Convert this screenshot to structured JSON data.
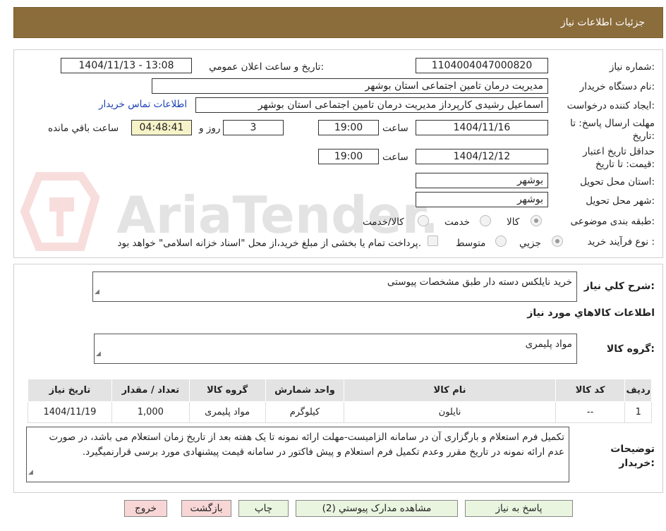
{
  "header": {
    "title": "جزئیات اطلاعات نیاز"
  },
  "form": {
    "need_number": {
      "label": "شماره نیاز:",
      "value": "1104004047000820"
    },
    "announce": {
      "label": "تاریخ و ساعت اعلان عمومي:",
      "value": "1404/11/13 - 13:08"
    },
    "buyer": {
      "label": "نام دستگاه خریدار:",
      "value": "مدیریت درمان تامین اجتماعی استان بوشهر"
    },
    "requester": {
      "label": "ایجاد کننده درخواست:",
      "value": "اسماعیل رشیدی کارپرداز مدیریت درمان تامین اجتماعی استان بوشهر",
      "contact_link": "اطلاعات تماس خریدار"
    },
    "deadline": {
      "label": "مهلت ارسال پاسخ: تا تاریخ:",
      "date": "1404/11/16",
      "time_label": "ساعت",
      "time": "19:00",
      "days": "3",
      "days_label": "روز و",
      "remaining": "04:48:41",
      "remaining_label": "ساعت باقي مانده"
    },
    "validity": {
      "label": "حداقل تاریخ اعتبار قیمت: تا تاریخ:",
      "date": "1404/12/12",
      "time_label": "ساعت",
      "time": "19:00"
    },
    "province": {
      "label": "استان محل تحویل:",
      "value": "بوشهر"
    },
    "city": {
      "label": "شهر محل تحویل:",
      "value": "بوشهر"
    },
    "category": {
      "label": "طبقه بندی موضوعی:",
      "options": [
        "کالا",
        "خدمت",
        "کالا/خدمت"
      ]
    },
    "process": {
      "label": "نوع فرآیند خرید :",
      "options": [
        "جزیي",
        "متوسط"
      ],
      "payment_note": "پرداخت تمام یا بخشی از مبلغ خرید،از محل \"اسناد خزانه اسلامی\" خواهد بود."
    }
  },
  "summary": {
    "label": "شرح کلي نیاز:",
    "value": "خرید نایلکس دسته دار طبق مشخصات پیوستی"
  },
  "goods_info_title": "اطلاعات کالاهاي مورد نیاز",
  "goods_group": {
    "label": "گروه کالا:",
    "value": "مواد پلیمری"
  },
  "table": {
    "headers": [
      "ردیف",
      "کد کالا",
      "نام کالا",
      "واحد شمارش",
      "گروه کالا",
      "تعداد / مقدار",
      "تاریخ نیاز"
    ],
    "rows": [
      [
        "1",
        "--",
        "نایلون",
        "کیلوگرم",
        "مواد پلیمری",
        "1,000",
        "1404/11/19"
      ]
    ]
  },
  "buyer_notes": {
    "label": "توضیحات خریدار:",
    "value": "تکمیل فرم استعلام و بارگزاری آن در سامانه الزامیست-مهلت ارائه نمونه تا یک هفته بعد از تاریخ زمان استعلام می باشد، در صورت عدم ارائه نمونه در تاریخ مقرر وعدم تکمیل فرم استعلام و پیش فاکتور در سامانه  قیمت پیشنهادی مورد برسی قرارنمیگیرد."
  },
  "buttons": {
    "reply": "پاسخ به نیاز",
    "attachments": "مشاهده مدارک پیوستي (2)",
    "print": "چاپ",
    "back": "بازگشت",
    "exit": "خروج"
  },
  "colors": {
    "header": "#8b6c3b",
    "button_green": "#e9f5df",
    "button_pink": "#f8d6d6",
    "remaining_bg": "#f7f3c8"
  }
}
